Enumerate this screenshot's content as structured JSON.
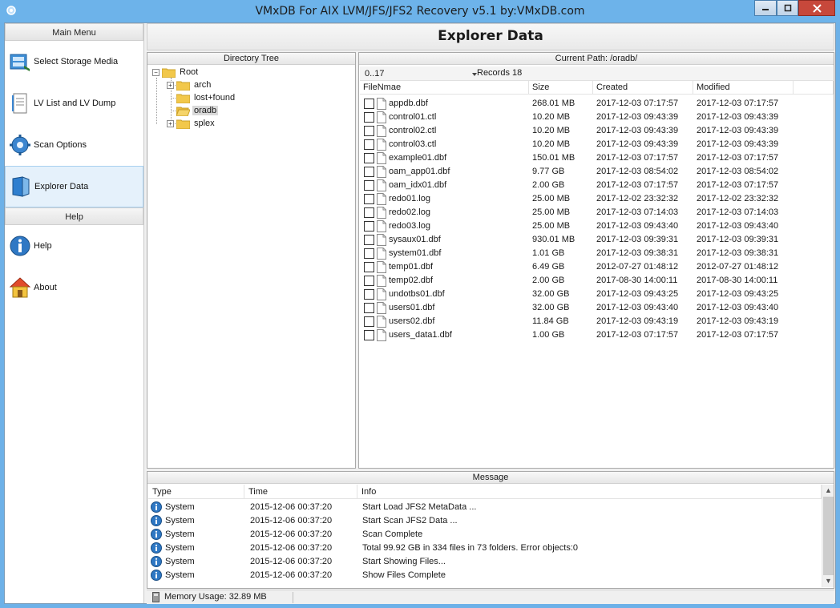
{
  "window": {
    "title": "VMxDB For AIX LVM/JFS/JFS2 Recovery v5.1 by:VMxDB.com"
  },
  "menu": {
    "main_header": "Main Menu",
    "items": [
      {
        "label": "Select Storage Media",
        "icon": "disk-icon"
      },
      {
        "label": "LV List and LV Dump",
        "icon": "lv-list-icon"
      },
      {
        "label": "Scan Options",
        "icon": "gear-icon"
      },
      {
        "label": "Explorer Data",
        "icon": "explorer-icon",
        "active": true
      }
    ],
    "help_header": "Help",
    "help_items": [
      {
        "label": "Help",
        "icon": "info-icon"
      },
      {
        "label": "About",
        "icon": "home-icon"
      }
    ]
  },
  "page_title": "Explorer Data",
  "tree": {
    "header": "Directory Tree",
    "root": "Root",
    "nodes": [
      {
        "label": "arch",
        "expandable": true
      },
      {
        "label": "lost+found",
        "expandable": false
      },
      {
        "label": "oradb",
        "expandable": false,
        "selected": true
      },
      {
        "label": "splex",
        "expandable": true
      }
    ]
  },
  "files": {
    "current_path_label": "Current Path: /oradb/",
    "range_value": "0..17",
    "records_label": "Records 18",
    "columns": [
      "FileNmae",
      "Size",
      "Created",
      "Modified"
    ],
    "rows": [
      [
        "appdb.dbf",
        "268.01 MB",
        "2017-12-03 07:17:57",
        "2017-12-03 07:17:57"
      ],
      [
        "control01.ctl",
        "10.20 MB",
        "2017-12-03 09:43:39",
        "2017-12-03 09:43:39"
      ],
      [
        "control02.ctl",
        "10.20 MB",
        "2017-12-03 09:43:39",
        "2017-12-03 09:43:39"
      ],
      [
        "control03.ctl",
        "10.20 MB",
        "2017-12-03 09:43:39",
        "2017-12-03 09:43:39"
      ],
      [
        "example01.dbf",
        "150.01 MB",
        "2017-12-03 07:17:57",
        "2017-12-03 07:17:57"
      ],
      [
        "oam_app01.dbf",
        "9.77 GB",
        "2017-12-03 08:54:02",
        "2017-12-03 08:54:02"
      ],
      [
        "oam_idx01.dbf",
        "2.00 GB",
        "2017-12-03 07:17:57",
        "2017-12-03 07:17:57"
      ],
      [
        "redo01.log",
        "25.00 MB",
        "2017-12-02 23:32:32",
        "2017-12-02 23:32:32"
      ],
      [
        "redo02.log",
        "25.00 MB",
        "2017-12-03 07:14:03",
        "2017-12-03 07:14:03"
      ],
      [
        "redo03.log",
        "25.00 MB",
        "2017-12-03 09:43:40",
        "2017-12-03 09:43:40"
      ],
      [
        "sysaux01.dbf",
        "930.01 MB",
        "2017-12-03 09:39:31",
        "2017-12-03 09:39:31"
      ],
      [
        "system01.dbf",
        "1.01 GB",
        "2017-12-03 09:38:31",
        "2017-12-03 09:38:31"
      ],
      [
        "temp01.dbf",
        "6.49 GB",
        "2012-07-27 01:48:12",
        "2012-07-27 01:48:12"
      ],
      [
        "temp02.dbf",
        "2.00 GB",
        "2017-08-30 14:00:11",
        "2017-08-30 14:00:11"
      ],
      [
        "undotbs01.dbf",
        "32.00 GB",
        "2017-12-03 09:43:25",
        "2017-12-03 09:43:25"
      ],
      [
        "users01.dbf",
        "32.00 GB",
        "2017-12-03 09:43:40",
        "2017-12-03 09:43:40"
      ],
      [
        "users02.dbf",
        "11.84 GB",
        "2017-12-03 09:43:19",
        "2017-12-03 09:43:19"
      ],
      [
        "users_data1.dbf",
        "1.00 GB",
        "2017-12-03 07:17:57",
        "2017-12-03 07:17:57"
      ]
    ]
  },
  "messages": {
    "header": "Message",
    "columns": [
      "Type",
      "Time",
      "Info"
    ],
    "rows": [
      [
        "System",
        "2015-12-06 00:37:20",
        "Start Load JFS2 MetaData ..."
      ],
      [
        "System",
        "2015-12-06 00:37:20",
        "Start Scan JFS2 Data ..."
      ],
      [
        "System",
        "2015-12-06 00:37:20",
        "Scan Complete"
      ],
      [
        "System",
        "2015-12-06 00:37:20",
        "Total 99.92 GB  in 334 files in 73 folders. Error objects:0"
      ],
      [
        "System",
        "2015-12-06 00:37:20",
        "Start Showing Files..."
      ],
      [
        "System",
        "2015-12-06 00:37:20",
        "Show Files Complete"
      ]
    ]
  },
  "status": {
    "memory": "Memory Usage: 32.89 MB"
  },
  "colors": {
    "titlebar": "#6db3ea",
    "active_menu": "#e5f1fb",
    "close_button": "#c7483b",
    "folder": "#f2c84b",
    "info_icon": "#2f78c4"
  }
}
